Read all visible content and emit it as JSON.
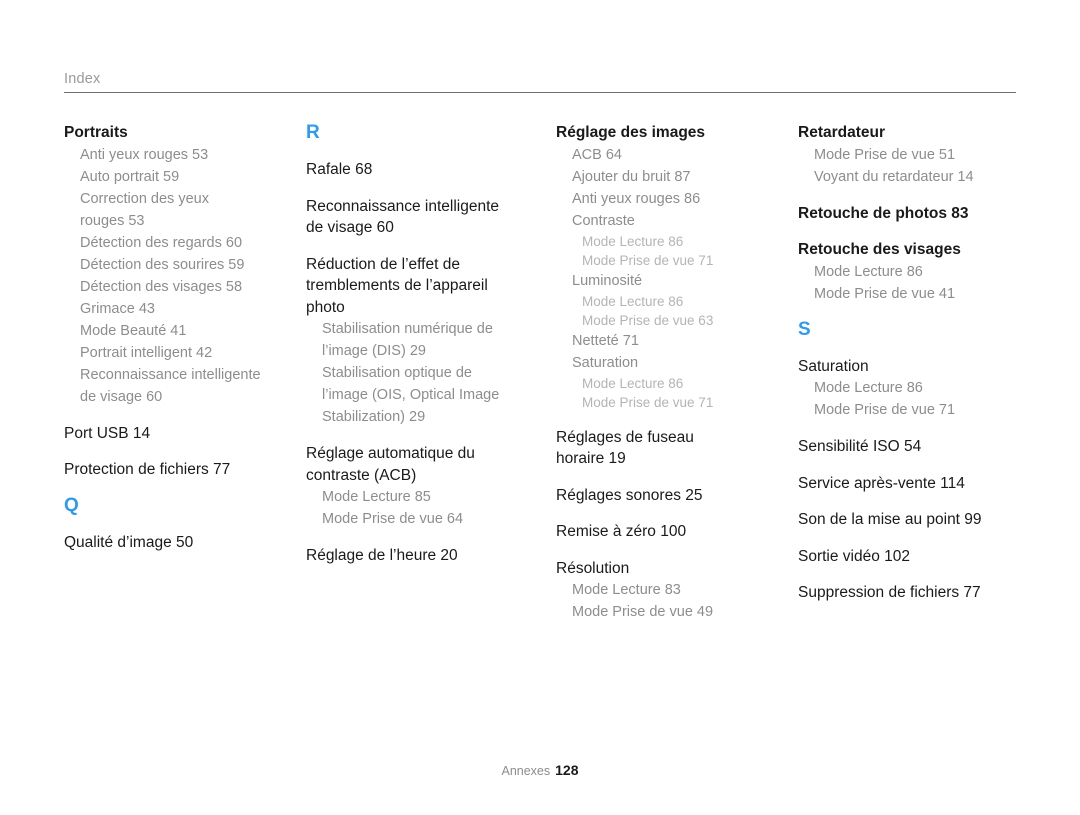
{
  "header": {
    "title": "Index"
  },
  "footer": {
    "section_label": "Annexes",
    "page_number": "128"
  },
  "colors": {
    "section_letter": "#2e9bf0",
    "heading_text": "#1a1a1a",
    "sub_entry_text": "#8d8d8d",
    "sub_sub_entry_text": "#b4b4b4",
    "header_text": "#9a9a9a",
    "rule": "#6f6f6f"
  },
  "columns": [
    {
      "blocks": [
        {
          "kind": "entry",
          "level": 1,
          "bold": true,
          "text": "Portraits"
        },
        {
          "kind": "entry",
          "level": 2,
          "text": "Anti yeux rouges  53"
        },
        {
          "kind": "entry",
          "level": 2,
          "text": "Auto portrait  59"
        },
        {
          "kind": "entry",
          "level": 2,
          "text": "Correction des yeux"
        },
        {
          "kind": "entry",
          "level": 2,
          "text": "rouges  53"
        },
        {
          "kind": "entry",
          "level": 2,
          "text": "Détection des regards  60"
        },
        {
          "kind": "entry",
          "level": 2,
          "text": "Détection des sourires  59"
        },
        {
          "kind": "entry",
          "level": 2,
          "text": "Détection des visages  58"
        },
        {
          "kind": "entry",
          "level": 2,
          "text": "Grimace  43"
        },
        {
          "kind": "entry",
          "level": 2,
          "text": "Mode Beauté  41"
        },
        {
          "kind": "entry",
          "level": 2,
          "text": "Portrait intelligent  42"
        },
        {
          "kind": "entry",
          "level": 2,
          "text": "Reconnaissance intelligente"
        },
        {
          "kind": "entry",
          "level": 2,
          "text": "de visage  60"
        },
        {
          "kind": "entry",
          "level": 1,
          "bold": false,
          "text": "Port USB  14"
        },
        {
          "kind": "entry",
          "level": 1,
          "bold": false,
          "text": "Protection de fichiers  77"
        },
        {
          "kind": "letter",
          "text": "Q"
        },
        {
          "kind": "entry",
          "level": 1,
          "bold": false,
          "text": "Qualité d’image  50"
        }
      ]
    },
    {
      "blocks": [
        {
          "kind": "letter",
          "text": "R"
        },
        {
          "kind": "entry",
          "level": 1,
          "bold": false,
          "text": "Rafale  68"
        },
        {
          "kind": "entry",
          "level": 1,
          "bold": false,
          "text": "Reconnaissance intelligente"
        },
        {
          "kind": "entry",
          "level": 1,
          "bold": false,
          "text": "de visage  60",
          "tight": true
        },
        {
          "kind": "entry",
          "level": 1,
          "bold": false,
          "text": "Réduction de l’effet de"
        },
        {
          "kind": "entry",
          "level": 1,
          "bold": false,
          "text": "tremblements de l’appareil",
          "tight": true
        },
        {
          "kind": "entry",
          "level": 1,
          "bold": false,
          "text": "photo",
          "tight": true
        },
        {
          "kind": "entry",
          "level": 2,
          "text": "Stabilisation numérique de"
        },
        {
          "kind": "entry",
          "level": 2,
          "text": "l’image (DIS)  29"
        },
        {
          "kind": "entry",
          "level": 2,
          "text": "Stabilisation optique de"
        },
        {
          "kind": "entry",
          "level": 2,
          "text": "l’image (OIS, Optical Image"
        },
        {
          "kind": "entry",
          "level": 2,
          "text": "Stabilization)  29"
        },
        {
          "kind": "entry",
          "level": 1,
          "bold": false,
          "text": "Réglage automatique du"
        },
        {
          "kind": "entry",
          "level": 1,
          "bold": false,
          "text": "contraste (ACB)",
          "tight": true
        },
        {
          "kind": "entry",
          "level": 2,
          "text": "Mode Lecture  85"
        },
        {
          "kind": "entry",
          "level": 2,
          "text": "Mode Prise de vue  64"
        },
        {
          "kind": "entry",
          "level": 1,
          "bold": false,
          "text": "Réglage de l’heure  20"
        }
      ]
    },
    {
      "blocks": [
        {
          "kind": "entry",
          "level": 1,
          "bold": true,
          "text": "Réglage des images"
        },
        {
          "kind": "entry",
          "level": 2,
          "text": "ACB  64"
        },
        {
          "kind": "entry",
          "level": 2,
          "text": "Ajouter du bruit  87"
        },
        {
          "kind": "entry",
          "level": 2,
          "text": "Anti yeux rouges  86"
        },
        {
          "kind": "entry",
          "level": 2,
          "text": "Contraste"
        },
        {
          "kind": "entry",
          "level": 3,
          "text": "Mode Lecture  86"
        },
        {
          "kind": "entry",
          "level": 3,
          "text": "Mode Prise de vue  71"
        },
        {
          "kind": "entry",
          "level": 2,
          "text": "Luminosité"
        },
        {
          "kind": "entry",
          "level": 3,
          "text": "Mode Lecture  86"
        },
        {
          "kind": "entry",
          "level": 3,
          "text": "Mode Prise de vue  63"
        },
        {
          "kind": "entry",
          "level": 2,
          "text": "Netteté  71"
        },
        {
          "kind": "entry",
          "level": 2,
          "text": "Saturation"
        },
        {
          "kind": "entry",
          "level": 3,
          "text": "Mode Lecture  86"
        },
        {
          "kind": "entry",
          "level": 3,
          "text": "Mode Prise de vue  71"
        },
        {
          "kind": "entry",
          "level": 1,
          "bold": false,
          "text": "Réglages de fuseau"
        },
        {
          "kind": "entry",
          "level": 1,
          "bold": false,
          "text": "horaire  19",
          "tight": true
        },
        {
          "kind": "entry",
          "level": 1,
          "bold": false,
          "text": "Réglages sonores  25"
        },
        {
          "kind": "entry",
          "level": 1,
          "bold": false,
          "text": "Remise à zéro  100"
        },
        {
          "kind": "entry",
          "level": 1,
          "bold": false,
          "text": "Résolution"
        },
        {
          "kind": "entry",
          "level": 2,
          "text": "Mode Lecture  83"
        },
        {
          "kind": "entry",
          "level": 2,
          "text": "Mode Prise de vue  49"
        }
      ]
    },
    {
      "blocks": [
        {
          "kind": "entry",
          "level": 1,
          "bold": true,
          "text": "Retardateur"
        },
        {
          "kind": "entry",
          "level": 2,
          "text": "Mode Prise de vue  51"
        },
        {
          "kind": "entry",
          "level": 2,
          "text": "Voyant du retardateur  14"
        },
        {
          "kind": "entry",
          "level": 1,
          "bold": true,
          "text": "Retouche de photos  83"
        },
        {
          "kind": "entry",
          "level": 1,
          "bold": true,
          "text": "Retouche des visages"
        },
        {
          "kind": "entry",
          "level": 2,
          "text": "Mode Lecture  86"
        },
        {
          "kind": "entry",
          "level": 2,
          "text": "Mode Prise de vue  41"
        },
        {
          "kind": "letter",
          "text": "S"
        },
        {
          "kind": "entry",
          "level": 1,
          "bold": false,
          "text": "Saturation"
        },
        {
          "kind": "entry",
          "level": 2,
          "text": "Mode Lecture  86"
        },
        {
          "kind": "entry",
          "level": 2,
          "text": "Mode Prise de vue  71"
        },
        {
          "kind": "entry",
          "level": 1,
          "bold": false,
          "text": "Sensibilité ISO  54"
        },
        {
          "kind": "entry",
          "level": 1,
          "bold": false,
          "text": "Service après-vente  114"
        },
        {
          "kind": "entry",
          "level": 1,
          "bold": false,
          "text": "Son de la mise au point  99"
        },
        {
          "kind": "entry",
          "level": 1,
          "bold": false,
          "text": "Sortie vidéo  102"
        },
        {
          "kind": "entry",
          "level": 1,
          "bold": false,
          "text": "Suppression de fichiers  77"
        }
      ]
    }
  ]
}
